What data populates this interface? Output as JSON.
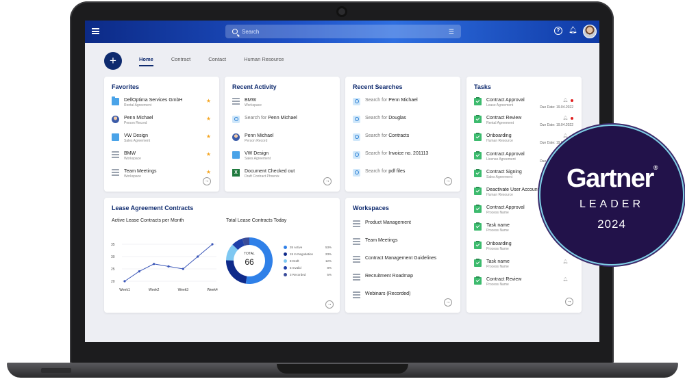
{
  "topbar": {
    "search_placeholder": "Search"
  },
  "tabs": [
    "Home",
    "Contract",
    "Contact",
    "Human Resource"
  ],
  "favorites": {
    "title": "Favorites",
    "items": [
      {
        "name": "DellOptima Services GmbH",
        "sub": "Rental Agreement",
        "icon": "folder-icon"
      },
      {
        "name": "Penn Michael",
        "sub": "Person Record",
        "icon": "person-icon"
      },
      {
        "name": "VW Design",
        "sub": "Sales Agreement",
        "icon": "document-icon"
      },
      {
        "name": "BMW",
        "sub": "Workspace",
        "icon": "workspace-icon"
      },
      {
        "name": "Team Meetings",
        "sub": "Workspace",
        "icon": "workspace-icon"
      }
    ]
  },
  "recent_activity": {
    "title": "Recent Activity",
    "items": [
      {
        "name": "BMW",
        "sub": "Workspace",
        "icon": "workspace-icon"
      },
      {
        "prefix": "Search for ",
        "name": "Penn Michael",
        "sub": "",
        "icon": "search-icon"
      },
      {
        "name": "Penn Michael",
        "sub": "Person Record",
        "icon": "person-icon"
      },
      {
        "name": "VW Design",
        "sub": "Sales Agreement",
        "icon": "document-icon"
      },
      {
        "name": "Document Checked out",
        "sub": "Draft Contract Phoenix",
        "icon": "excel-icon"
      }
    ]
  },
  "recent_searches": {
    "title": "Recent Searches",
    "items": [
      {
        "prefix": "Search for ",
        "name": "Penn Michael"
      },
      {
        "prefix": "Search for ",
        "name": "Douglas"
      },
      {
        "prefix": "Search for ",
        "name": "Contracts"
      },
      {
        "prefix": "Search for ",
        "name": "Invoice no. 201113"
      },
      {
        "prefix": "Search for ",
        "name": "pdf files"
      }
    ]
  },
  "tasks": {
    "title": "Tasks",
    "items": [
      {
        "name": "Contract Approval",
        "sub": "Lease Agreement",
        "due": "Due Date: 19.04.2022",
        "flag": true
      },
      {
        "name": "Contract Review",
        "sub": "Rental Agreement",
        "due": "Due Date: 19.04.2022",
        "flag": true
      },
      {
        "name": "Onboarding",
        "sub": "Human Resource",
        "due": "Due Date: 19.04.2022",
        "flag": false
      },
      {
        "name": "Contract Approval",
        "sub": "License Agreement",
        "due": "Due Date: 19.04.2022",
        "flag": false
      },
      {
        "name": "Contract Signing",
        "sub": "Sales Agreement",
        "due": "Due Date: 19.04.2022",
        "flag": false
      },
      {
        "name": "Deactivate User Account",
        "sub": "Human Resource",
        "due": "",
        "flag": false
      },
      {
        "name": "Contract Approval",
        "sub": "Process Name",
        "due": "",
        "flag": false
      },
      {
        "name": "Task name",
        "sub": "Process Name",
        "due": "",
        "flag": false
      },
      {
        "name": "Onboarding",
        "sub": "Process Name",
        "due": "",
        "flag": false
      },
      {
        "name": "Task name",
        "sub": "Process Name",
        "due": "",
        "flag": false
      },
      {
        "name": "Contract Review",
        "sub": "Process Name",
        "due": "",
        "flag": false
      }
    ]
  },
  "lease": {
    "title": "Lease Agreement Contracts",
    "line_title": "Active Lease Contracts per Month",
    "donut_title": "Total Lease Contracts Today",
    "donut_center_label": "TOTAL",
    "donut_total": "66"
  },
  "chart_data": [
    {
      "type": "line",
      "title": "Active Lease Contracts per Month",
      "categories": [
        "Week1",
        "Week2",
        "Week3",
        "Week4"
      ],
      "x": [
        1,
        1.5,
        2,
        2.5,
        3,
        3.5,
        4
      ],
      "values": [
        20,
        24,
        27,
        26,
        25,
        30,
        35
      ],
      "yticks": [
        20,
        25,
        30,
        35
      ],
      "ylim": [
        20,
        35
      ],
      "color": "#3a56b8"
    },
    {
      "type": "pie",
      "title": "Total Lease Contracts Today",
      "total": 66,
      "slices": [
        {
          "name": "Active",
          "label": "35 Active",
          "pct": "53%",
          "value": 53,
          "color": "#2f80e8"
        },
        {
          "name": "In Negotiation",
          "label": "15 In Negotiation",
          "pct": "23%",
          "value": 23,
          "color": "#0e2a8a"
        },
        {
          "name": "Draft",
          "label": "8 Draft",
          "pct": "12%",
          "value": 12,
          "color": "#7ec8f2"
        },
        {
          "name": "Invalid",
          "label": "5 Invalid",
          "pct": "8%",
          "value": 8,
          "color": "#1f3fa8"
        },
        {
          "name": "Recorded",
          "label": "3 Recorded",
          "pct": "5%",
          "value": 5,
          "color": "#3a4c9a"
        }
      ]
    }
  ],
  "workspaces": {
    "title": "Workspaces",
    "items": [
      "Product Management",
      "Team Meetings",
      "Contract Management Guidelines",
      "Recruitment Roadmap",
      "Webinars (Recorded)"
    ]
  },
  "badge": {
    "brand": "Gartner",
    "brand_mark": "®",
    "label": "LEADER",
    "year": "2024"
  }
}
